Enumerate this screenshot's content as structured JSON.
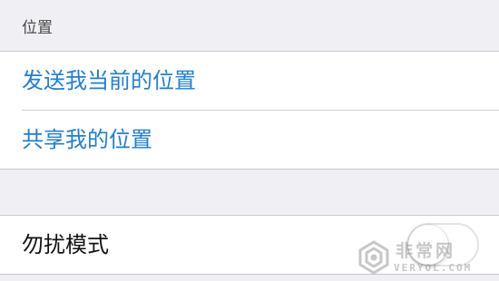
{
  "location_section": {
    "header": "位置",
    "items": [
      {
        "label": "发送我当前的位置"
      },
      {
        "label": "共享我的位置"
      }
    ]
  },
  "dnd_section": {
    "label": "勿扰模式",
    "toggle_on": false
  },
  "watermark": {
    "cn": "非常网",
    "en": "VERYOL.COM"
  },
  "colors": {
    "background": "#efeff4",
    "link": "#1e7ed8",
    "cell": "#ffffff",
    "separator": "#c8c7cc"
  }
}
